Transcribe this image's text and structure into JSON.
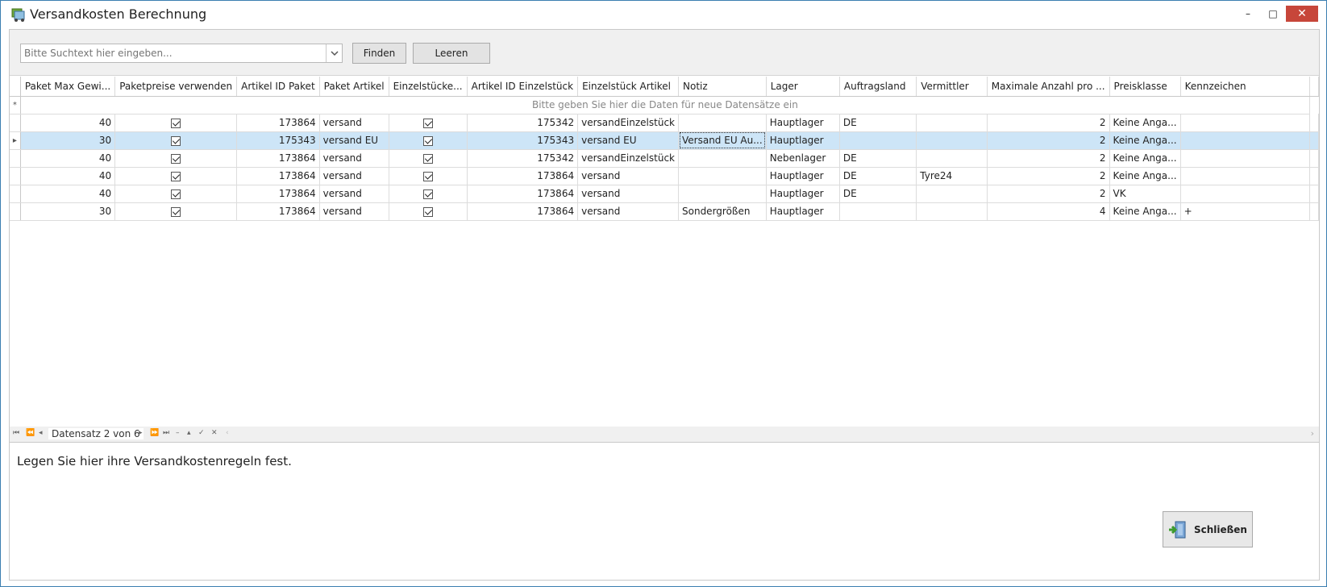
{
  "window": {
    "title": "Versandkosten Berechnung",
    "minimize": "–",
    "maximize": "□",
    "close": "✕"
  },
  "search": {
    "placeholder": "Bitte Suchtext hier eingeben...",
    "value": "",
    "find_label": "Finden",
    "clear_label": "Leeren"
  },
  "grid": {
    "columns": [
      "Paket Max Gewi...",
      "Paketpreise verwenden",
      "Artikel ID Paket",
      "Paket Artikel",
      "Einzelstücke...",
      "Artikel ID Einzelstück",
      "Einzelstück Artikel",
      "Notiz",
      "Lager",
      "Auftragsland",
      "Vermittler",
      "Maximale Anzahl pro ...",
      "Preisklasse",
      "Kennzeichen"
    ],
    "new_row_text": "Bitte geben Sie hier die Daten  für neue Datensätze ein",
    "new_row_marker": "*",
    "current_row_marker": "▸",
    "rows": [
      {
        "max_weight": "40",
        "paketpreise": true,
        "artikel_id_paket": "173864",
        "paket_artikel": "versand",
        "einzelstuecke": true,
        "artikel_id_einzel": "175342",
        "einzel_artikel": "versandEinzelstück",
        "notiz": "",
        "lager": "Hauptlager",
        "auftragsland": "DE",
        "vermittler": "",
        "max_anzahl": "2",
        "preisklasse": "Keine Anga...",
        "kennzeichen": ""
      },
      {
        "max_weight": "30",
        "paketpreise": true,
        "artikel_id_paket": "175343",
        "paket_artikel": "versand EU",
        "einzelstuecke": true,
        "artikel_id_einzel": "175343",
        "einzel_artikel": "versand EU",
        "notiz": "Versand EU Au...",
        "lager": "Hauptlager",
        "auftragsland": "",
        "vermittler": "",
        "max_anzahl": "2",
        "preisklasse": "Keine Anga...",
        "kennzeichen": ""
      },
      {
        "max_weight": "40",
        "paketpreise": true,
        "artikel_id_paket": "173864",
        "paket_artikel": "versand",
        "einzelstuecke": true,
        "artikel_id_einzel": "175342",
        "einzel_artikel": "versandEinzelstück",
        "notiz": "",
        "lager": "Nebenlager",
        "auftragsland": "DE",
        "vermittler": "",
        "max_anzahl": "2",
        "preisklasse": "Keine Anga...",
        "kennzeichen": ""
      },
      {
        "max_weight": "40",
        "paketpreise": true,
        "artikel_id_paket": "173864",
        "paket_artikel": "versand",
        "einzelstuecke": true,
        "artikel_id_einzel": "173864",
        "einzel_artikel": "versand",
        "notiz": "",
        "lager": "Hauptlager",
        "auftragsland": "DE",
        "vermittler": "Tyre24",
        "max_anzahl": "2",
        "preisklasse": "Keine Anga...",
        "kennzeichen": ""
      },
      {
        "max_weight": "40",
        "paketpreise": true,
        "artikel_id_paket": "173864",
        "paket_artikel": "versand",
        "einzelstuecke": true,
        "artikel_id_einzel": "173864",
        "einzel_artikel": "versand",
        "notiz": "",
        "lager": "Hauptlager",
        "auftragsland": "DE",
        "vermittler": "",
        "max_anzahl": "2",
        "preisklasse": "VK",
        "kennzeichen": ""
      },
      {
        "max_weight": "30",
        "paketpreise": true,
        "artikel_id_paket": "173864",
        "paket_artikel": "versand",
        "einzelstuecke": true,
        "artikel_id_einzel": "173864",
        "einzel_artikel": "versand",
        "notiz": "Sondergrößen",
        "lager": "Hauptlager",
        "auftragsland": "",
        "vermittler": "",
        "max_anzahl": "4",
        "preisklasse": "Keine Anga...",
        "kennzeichen": "+"
      }
    ],
    "selected_row_index": 1
  },
  "navigator": {
    "record_text": "Datensatz 2 von 6"
  },
  "footer": {
    "description": "Legen Sie hier ihre Versandkostenregeln fest.",
    "close_label": "Schließen"
  },
  "colors": {
    "title_close_bg": "#c7463a",
    "selected_row_bg": "#cde5f7",
    "window_border": "#3c7fb1"
  }
}
